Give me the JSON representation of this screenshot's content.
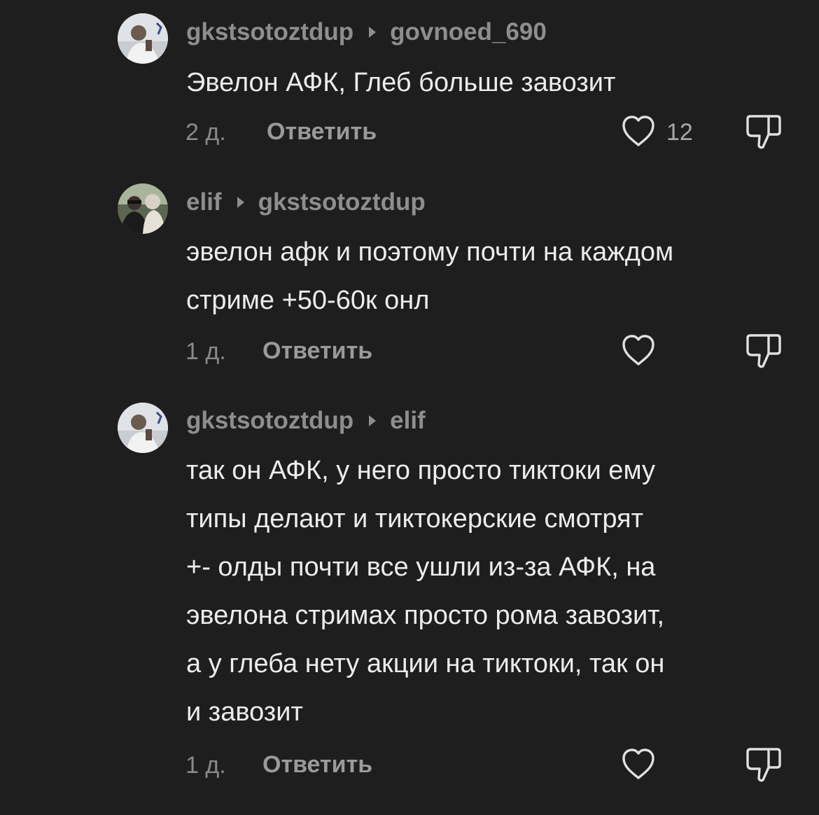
{
  "comments": [
    {
      "author": "gkstsotoztdup",
      "reply_to": "govnoed_690",
      "avatar": "avatar-gkstsotoztdup",
      "text": "Эвелон АФК, Глеб больше завозит",
      "time": "2 д.",
      "reply_label": "Ответить",
      "likes": "12"
    },
    {
      "author": "elif",
      "reply_to": "gkstsotoztdup",
      "avatar": "avatar-elif",
      "text": "эвелон афк и поэтому почти на каждом\nстриме +50-60к онл",
      "time": "1 д.",
      "reply_label": "Ответить",
      "likes": ""
    },
    {
      "author": "gkstsotoztdup",
      "reply_to": "elif",
      "avatar": "avatar-gkstsotoztdup",
      "text": "так он АФК, у него просто тиктоки ему\nтипы делают и тиктокерские смотрят\n+- олды почти все ушли из-за АФК, на\nэвелона стримах просто рома завозит,\nа у глеба нету акции на тиктоки, так он\nи завозит",
      "time": "1 д.",
      "reply_label": "Ответить",
      "likes": ""
    }
  ],
  "icons": {
    "like": "heart-icon",
    "dislike": "thumbs-down-icon",
    "reply_separator": "caret-right-icon"
  },
  "colors": {
    "background": "#1e1e1e",
    "text": "#ececec",
    "secondary": "#8e8e8e"
  }
}
